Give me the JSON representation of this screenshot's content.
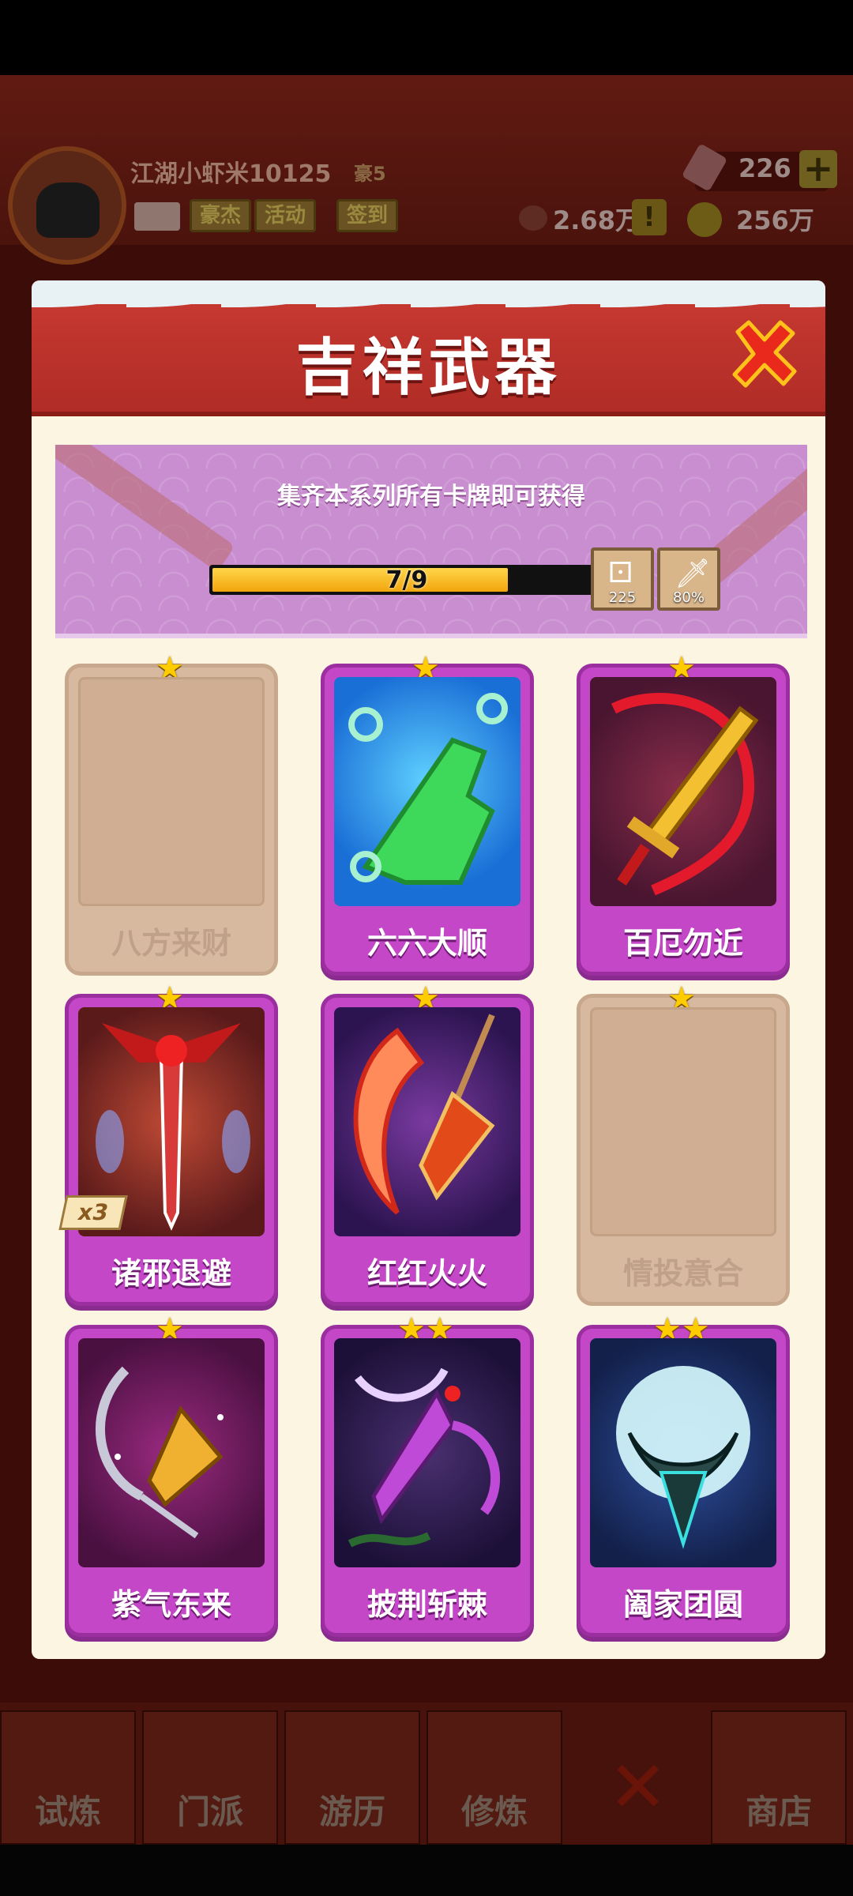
{
  "background": {
    "player_name": "江湖小虾米10125",
    "player_rank": "豪5",
    "buttons": [
      "豪杰",
      "活动",
      "签到"
    ],
    "gems": "226",
    "power": "2.68万",
    "coins": "256万",
    "nav": [
      "试炼",
      "门派",
      "游历",
      "修炼",
      "商店"
    ]
  },
  "dialog": {
    "title": "吉祥武器",
    "banner_text": "集齐本系列所有卡牌即可获得",
    "progress_text": "7/9",
    "progress_fraction": 0.76,
    "rewards": [
      {
        "icon": "dice-icon",
        "value": "225"
      },
      {
        "icon": "sword-icon",
        "value": "80%"
      }
    ],
    "cards": [
      {
        "name": "八方来财",
        "stars": "★",
        "collected": false
      },
      {
        "name": "六六大顺",
        "stars": "★",
        "collected": true
      },
      {
        "name": "百厄勿近",
        "stars": "★",
        "collected": true
      },
      {
        "name": "诸邪退避",
        "stars": "★",
        "collected": true,
        "count": "x3"
      },
      {
        "name": "红红火火",
        "stars": "★",
        "collected": true
      },
      {
        "name": "情投意合",
        "stars": "★",
        "collected": false
      },
      {
        "name": "紫气东来",
        "stars": "★",
        "collected": true
      },
      {
        "name": "披荆斩棘",
        "stars": "★★",
        "collected": true
      },
      {
        "name": "阖家团圆",
        "stars": "★★",
        "collected": true
      }
    ]
  },
  "colors": {
    "header_red": "#c93b33",
    "card_purple": "#c447c8",
    "card_empty": "#d7b99f",
    "progress_gold": "#f2a60d"
  }
}
